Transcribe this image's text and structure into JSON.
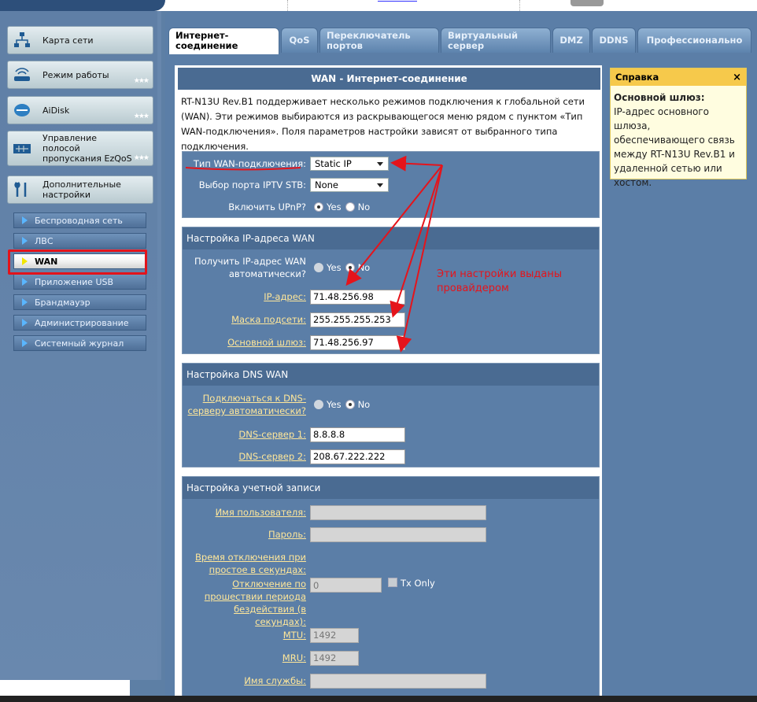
{
  "sidebar": {
    "menu": [
      {
        "label": "Карта сети",
        "icon": "network-map-icon"
      },
      {
        "label": "Режим работы",
        "icon": "router-icon"
      },
      {
        "label": "AiDisk",
        "icon": "disk-icon"
      },
      {
        "label": "Управление полосой пропускания EzQoS",
        "icon": "bandwidth-icon"
      },
      {
        "label": "Дополнительные настройки",
        "icon": "tools-icon"
      }
    ],
    "sub_items": [
      {
        "label": "Беспроводная сеть"
      },
      {
        "label": "ЛВС"
      },
      {
        "label": "WAN"
      },
      {
        "label": "Приложение USB"
      },
      {
        "label": "Брандмауэр"
      },
      {
        "label": "Администрирование"
      },
      {
        "label": "Системный журнал"
      }
    ]
  },
  "tabs": [
    {
      "label": "Интернет-соединение"
    },
    {
      "label": "QoS"
    },
    {
      "label": "Переключатель портов"
    },
    {
      "label": "Виртуальный сервер"
    },
    {
      "label": "DMZ"
    },
    {
      "label": "DDNS"
    },
    {
      "label": "Профессионально"
    }
  ],
  "page": {
    "title": "WAN - Интернет-соединение",
    "intro": "RT-N13U Rev.B1 поддерживает несколько режимов подключения к глобальной сети (WAN). Эти режимов выбираются из раскрывающегося меню рядом с пунктом «Тип WAN-подключения». Поля параметров настройки зависят от выбранного типа подключения."
  },
  "wan_type": {
    "label": "Тип WAN-подключения:",
    "value": "Static IP",
    "iptv_label": "Выбор порта IPTV STB:",
    "iptv_value": "None",
    "upnp_label": "Включить UPnP?",
    "yes": "Yes",
    "no": "No"
  },
  "ip_section": {
    "title": "Настройка IP-адреса WAN",
    "auto_label": "Получить IP-адрес WAN автоматически?",
    "yes": "Yes",
    "no": "No",
    "ip_label": "IP-адрес:",
    "ip_value": "71.48.256.98",
    "mask_label": "Маска подсети:",
    "mask_value": "255.255.255.253",
    "gw_label": "Основной шлюз:",
    "gw_value": "71.48.256.97"
  },
  "dns_section": {
    "title": "Настройка DNS WAN",
    "auto_label": "Подключаться к DNS-серверу автоматически?",
    "yes": "Yes",
    "no": "No",
    "dns1_label": "DNS-сервер 1:",
    "dns1_value": "8.8.8.8",
    "dns2_label": "DNS-сервер 2:",
    "dns2_value": "208.67.222.222"
  },
  "account_section": {
    "title": "Настройка учетной записи",
    "user_label": "Имя пользователя:",
    "pass_label": "Пароль:",
    "idle_label": "Время отключения при простое в секундах:",
    "idle_label2": "Отключение по прошествии периода бездействия (в секундах):",
    "idle_value": "0",
    "tx_only": "Tx Only",
    "mtu_label": "MTU:",
    "mtu_value": "1492",
    "mru_label": "MRU:",
    "mru_value": "1492",
    "service_label": "Имя службы:"
  },
  "help": {
    "title": "Справка",
    "close": "×",
    "heading": "Основной шлюз:",
    "text": "IP-адрес основного шлюза, обеспечивающего связь между RT-N13U Rev.B1 и удаленной сетью или хостом."
  },
  "annotation": {
    "text": "Эти настройки выданы провайдером",
    "color": "#e5141b"
  }
}
